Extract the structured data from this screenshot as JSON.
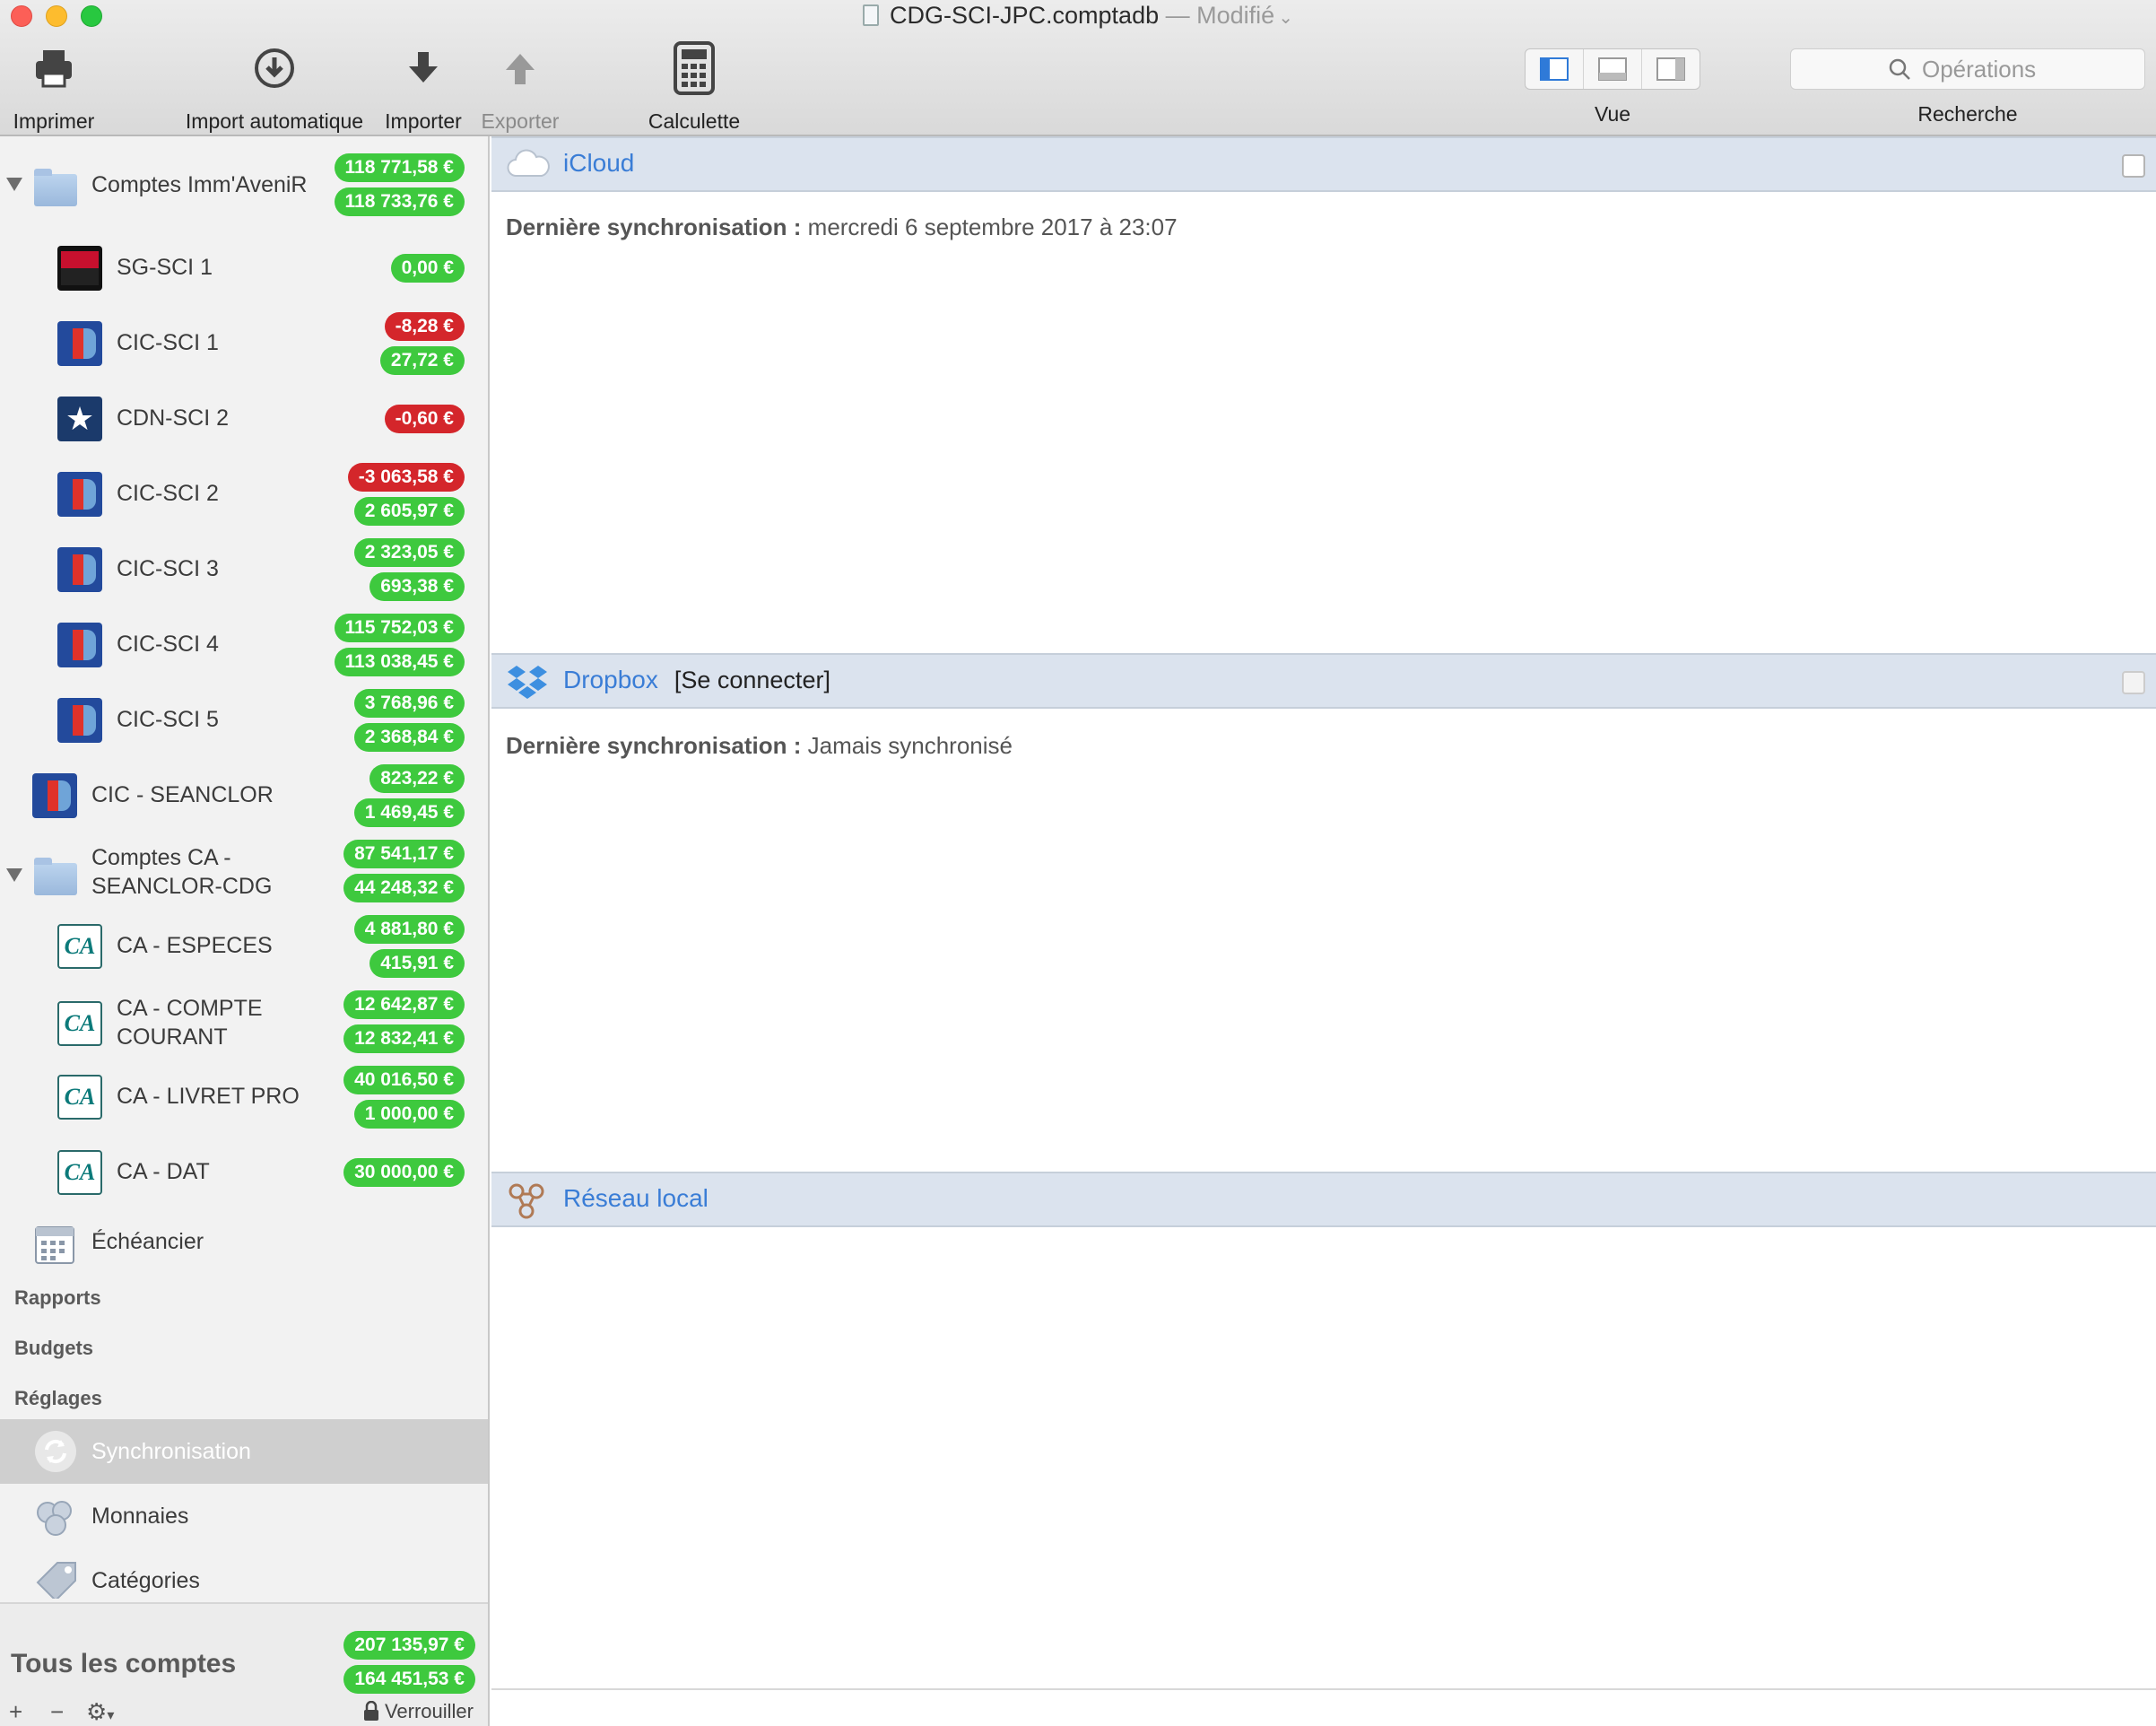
{
  "window": {
    "title": "CDG-SCI-JPC.comptadb",
    "separator": "—",
    "status": "Modifié"
  },
  "toolbar": {
    "print": "Imprimer",
    "auto_import": "Import automatique",
    "import": "Importer",
    "export": "Exporter",
    "calculator": "Calculette",
    "view": "Vue",
    "search_placeholder": "Opérations",
    "search": "Recherche"
  },
  "sidebar": {
    "groups": [
      {
        "name": "Comptes Imm'AveniR",
        "balances": [
          "118 771,58 €",
          "118 733,76 €"
        ]
      },
      {
        "name_line1": "Comptes CA -",
        "name_line2": "SEANCLOR-CDG",
        "balances": [
          "87 541,17 €",
          "44 248,32 €"
        ]
      }
    ],
    "accounts": [
      {
        "name": "SG-SCI 1",
        "bank": "sg",
        "balances": [
          "0,00 €"
        ]
      },
      {
        "name": "CIC-SCI 1",
        "bank": "cic",
        "balances": [
          "-8,28 €",
          "27,72 €"
        ]
      },
      {
        "name": "CDN-SCI 2",
        "bank": "cdn",
        "balances": [
          "-0,60 €"
        ]
      },
      {
        "name": "CIC-SCI 2",
        "bank": "cic",
        "balances": [
          "-3 063,58 €",
          "2 605,97 €"
        ]
      },
      {
        "name": "CIC-SCI 3",
        "bank": "cic",
        "balances": [
          "2 323,05 €",
          "693,38 €"
        ]
      },
      {
        "name": "CIC-SCI 4",
        "bank": "cic",
        "balances": [
          "115 752,03 €",
          "113 038,45 €"
        ]
      },
      {
        "name": "CIC-SCI 5",
        "bank": "cic",
        "balances": [
          "3 768,96 €",
          "2 368,84 €"
        ]
      },
      {
        "name": "CIC - SEANCLOR",
        "bank": "cic",
        "balances": [
          "823,22 €",
          "1 469,45 €"
        ]
      },
      {
        "name": "CA - ESPECES",
        "bank": "ca",
        "balances": [
          "4 881,80 €",
          "415,91 €"
        ]
      },
      {
        "name_line1": "CA - COMPTE",
        "name_line2": "COURANT",
        "bank": "ca",
        "balances": [
          "12 642,87 €",
          "12 832,41 €"
        ]
      },
      {
        "name": "CA - LIVRET PRO",
        "bank": "ca",
        "balances": [
          "40 016,50 €",
          "1 000,00 €"
        ]
      },
      {
        "name": "CA - DAT",
        "bank": "ca",
        "balances": [
          "30 000,00 €"
        ]
      }
    ],
    "scheduler": "Échéancier",
    "sections": {
      "reports": "Rapports",
      "budgets": "Budgets",
      "settings": "Réglages"
    },
    "settings_items": {
      "sync": "Synchronisation",
      "currencies": "Monnaies",
      "categories": "Catégories"
    },
    "total": {
      "label": "Tous les comptes",
      "balances": [
        "207 135,97 €",
        "164 451,53 €"
      ]
    },
    "footer": {
      "add": "+",
      "remove": "−",
      "lock": "Verrouiller"
    }
  },
  "main": {
    "icloud": {
      "title": "iCloud",
      "last_sync_label": "Dernière synchronisation :",
      "last_sync_value": "mercredi 6 septembre 2017 à 23:07"
    },
    "dropbox": {
      "title": "Dropbox",
      "connect": "[Se connecter]",
      "last_sync_label": "Dernière synchronisation :",
      "last_sync_value": "Jamais synchronisé"
    },
    "local": {
      "title": "Réseau local"
    }
  },
  "colors": {
    "positive": "#3ec93e",
    "negative": "#d4262b",
    "link": "#3a7dd6"
  }
}
